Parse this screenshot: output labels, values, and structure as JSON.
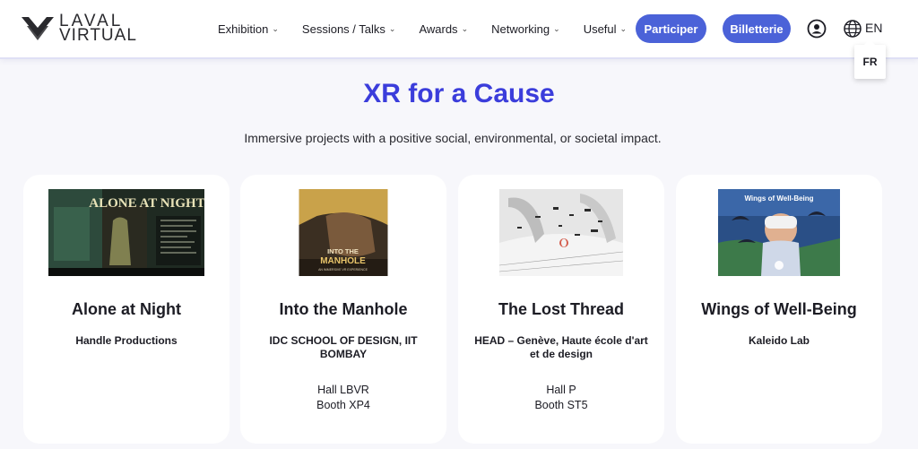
{
  "header": {
    "logo": {
      "line1": "LAVAL",
      "line2": "VIRTUAL"
    },
    "nav": [
      {
        "label": "Exhibition"
      },
      {
        "label": "Sessions / Talks"
      },
      {
        "label": "Awards"
      },
      {
        "label": "Networking"
      },
      {
        "label": "Useful"
      }
    ],
    "buttons": {
      "participer": "Participer",
      "billetterie": "Billetterie"
    },
    "language": {
      "current": "EN",
      "dropdown_option": "FR"
    }
  },
  "page": {
    "title": "XR for a Cause",
    "subtitle": "Immersive projects with a positive social, environmental, or societal impact."
  },
  "cards": [
    {
      "title": "Alone at Night",
      "org": "Handle Productions",
      "hall": "",
      "booth": "",
      "image_text": "ALONE AT NIGHT"
    },
    {
      "title": "Into the Manhole",
      "org": "IDC SCHOOL OF DESIGN, IIT BOMBAY",
      "hall": "Hall LBVR",
      "booth": "Booth XP4",
      "image_text": "INTO THE MANHOLE"
    },
    {
      "title": "The Lost Thread",
      "org": "HEAD – Genève, Haute école d'art et de design",
      "hall": "Hall P",
      "booth": "Booth ST5",
      "image_text": ""
    },
    {
      "title": "Wings of Well-Being",
      "org": "Kaleido Lab",
      "hall": "",
      "booth": "",
      "image_text": "Wings of Well-Being"
    }
  ],
  "colors": {
    "accent": "#3b3ddb",
    "button": "#4b62d8",
    "background": "#f7f7fb"
  }
}
